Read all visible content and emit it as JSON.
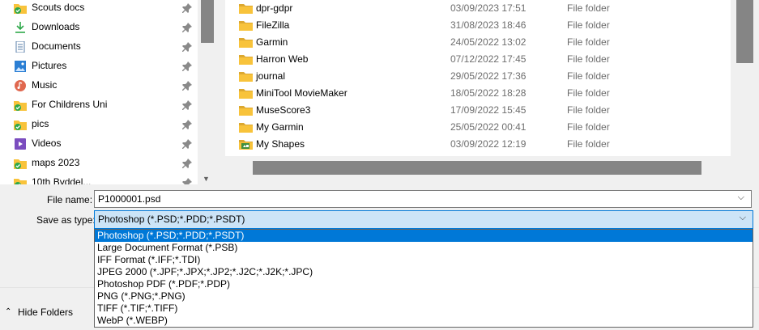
{
  "nav": {
    "items": [
      {
        "label": "Scouts docs",
        "icon": "sync-folder-icon",
        "pinned": true
      },
      {
        "label": "Downloads",
        "icon": "download-arrow-icon",
        "pinned": true
      },
      {
        "label": "Documents",
        "icon": "documents-icon",
        "pinned": true
      },
      {
        "label": "Pictures",
        "icon": "pictures-icon",
        "pinned": true
      },
      {
        "label": "Music",
        "icon": "music-icon",
        "pinned": true
      },
      {
        "label": "For Childrens Uni",
        "icon": "sync-folder-icon",
        "pinned": true
      },
      {
        "label": "pics",
        "icon": "sync-folder-icon",
        "pinned": true
      },
      {
        "label": "Videos",
        "icon": "videos-icon",
        "pinned": true
      },
      {
        "label": "maps 2023",
        "icon": "sync-folder-icon",
        "pinned": true
      },
      {
        "label": "10th Byddel...",
        "icon": "sync-folder-icon",
        "pinned": true
      }
    ]
  },
  "files": [
    {
      "name": "dpr-gdpr",
      "date": "03/09/2023 17:51",
      "type": "File folder",
      "icon": "folder-icon"
    },
    {
      "name": "FileZilla",
      "date": "31/08/2023 18:46",
      "type": "File folder",
      "icon": "folder-icon"
    },
    {
      "name": "Garmin",
      "date": "24/05/2022 13:02",
      "type": "File folder",
      "icon": "folder-icon"
    },
    {
      "name": "Harron Web",
      "date": "07/12/2022 17:45",
      "type": "File folder",
      "icon": "folder-icon"
    },
    {
      "name": "journal",
      "date": "29/05/2022 17:36",
      "type": "File folder",
      "icon": "folder-icon"
    },
    {
      "name": "MiniTool MovieMaker",
      "date": "18/05/2022 18:28",
      "type": "File folder",
      "icon": "folder-icon"
    },
    {
      "name": "MuseScore3",
      "date": "17/09/2022 15:45",
      "type": "File folder",
      "icon": "folder-icon"
    },
    {
      "name": "My Garmin",
      "date": "25/05/2022 00:41",
      "type": "File folder",
      "icon": "folder-icon"
    },
    {
      "name": "My Shapes",
      "date": "03/09/2022 12:19",
      "type": "File folder",
      "icon": "shapes-folder-icon"
    }
  ],
  "form": {
    "filename_label": "File name:",
    "filename_value": "P1000001.psd",
    "savetype_label": "Save as type:",
    "savetype_value": "Photoshop (*.PSD;*.PDD;*.PSDT)",
    "hide_folders_label": "Hide Folders"
  },
  "dropdown": {
    "selected_index": 0,
    "options": [
      "Photoshop (*.PSD;*.PDD;*.PSDT)",
      "Large Document Format (*.PSB)",
      "IFF Format (*.IFF;*.TDI)",
      "JPEG 2000 (*.JPF;*.JPX;*.JP2;*.J2C;*.J2K;*.JPC)",
      "Photoshop PDF (*.PDF;*.PDP)",
      "PNG (*.PNG;*.PNG)",
      "TIFF (*.TIF;*.TIFF)",
      "WebP (*.WEBP)"
    ]
  },
  "colors": {
    "selection": "#0078d7",
    "combo_highlight": "#cce4f7",
    "folder": "#f8c33b",
    "sync_check": "#2ea84a"
  }
}
